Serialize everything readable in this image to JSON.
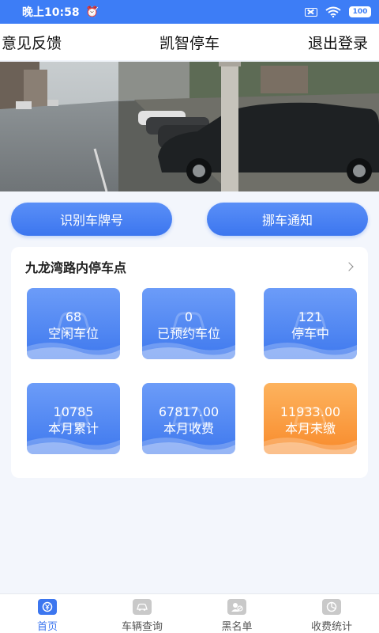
{
  "status_bar": {
    "time": "晚上10:58",
    "battery": "100"
  },
  "header": {
    "left": "意见反馈",
    "title": "凯智停车",
    "right": "退出登录"
  },
  "actions": {
    "recognize": "识别车牌号",
    "move_car": "挪车通知"
  },
  "lot": {
    "name": "九龙湾路内停车点",
    "stats": [
      {
        "value": "68",
        "label": "空闲车位"
      },
      {
        "value": "0",
        "label": "已预约车位"
      },
      {
        "value": "121",
        "label": "停车中"
      },
      {
        "value": "10785",
        "label": "本月累计"
      },
      {
        "value": "67817.00",
        "label": "本月收费"
      },
      {
        "value": "11933.00",
        "label": "本月未缴"
      }
    ]
  },
  "nav": {
    "items": [
      {
        "label": "首页",
        "icon": "home-icon"
      },
      {
        "label": "车辆查询",
        "icon": "car-search-icon"
      },
      {
        "label": "黑名单",
        "icon": "blacklist-icon"
      },
      {
        "label": "收费统计",
        "icon": "stats-icon"
      }
    ]
  },
  "colors": {
    "primary": "#3c76ef",
    "accent": "#f88b2c",
    "status_bar": "#3d7df6"
  }
}
